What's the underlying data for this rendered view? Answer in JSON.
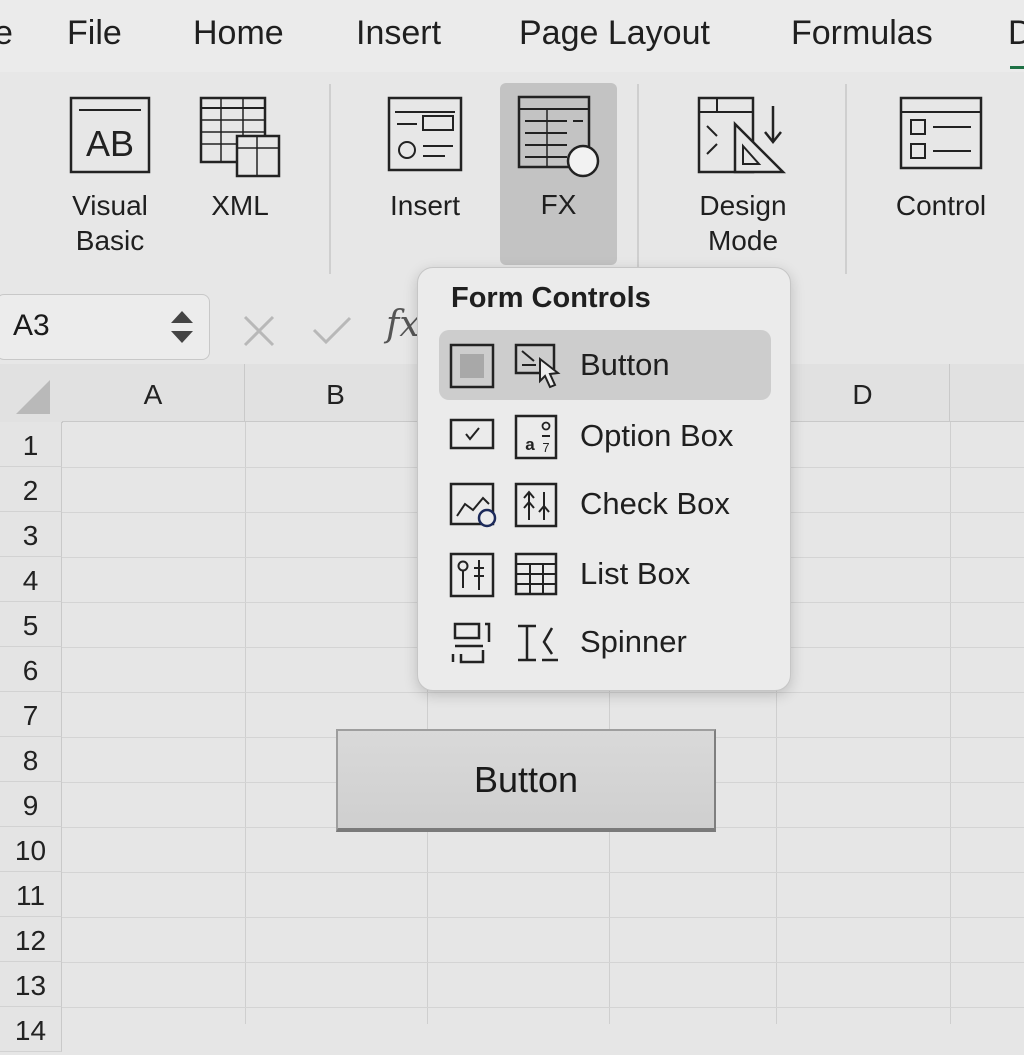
{
  "menubar": {
    "tabs": [
      {
        "label": "e"
      },
      {
        "label": "File"
      },
      {
        "label": "Home"
      },
      {
        "label": "Insert"
      },
      {
        "label": "Page Layout"
      },
      {
        "label": "Formulas"
      },
      {
        "label": "D"
      }
    ]
  },
  "ribbon": {
    "visual_basic": {
      "label": "Visual\nBasic",
      "icon": "visual-basic-icon"
    },
    "xml": {
      "label": "XML",
      "icon": "xml-icon"
    },
    "insert": {
      "label": "Insert",
      "icon": "insert-controls-icon"
    },
    "fx": {
      "label": "FX",
      "icon": "fx-icon"
    },
    "design_mode": {
      "label": "Design\nMode",
      "icon": "design-mode-icon"
    },
    "control": {
      "label": "Control",
      "icon": "control-icon"
    }
  },
  "formula_bar": {
    "name_box": "A3",
    "fx": "fx"
  },
  "grid": {
    "columns": [
      "A",
      "B",
      "",
      "",
      "D"
    ],
    "rows": [
      "1",
      "2",
      "3",
      "4",
      "5",
      "6",
      "7",
      "8",
      "9",
      "10",
      "11",
      "12",
      "13",
      "14"
    ],
    "sheet_button_label": "Button"
  },
  "dropdown": {
    "title": "Form Controls",
    "items": [
      {
        "label": "Button",
        "icons": [
          "square-stop-icon",
          "cursor-select-icon"
        ],
        "selected": true
      },
      {
        "label": "Option Box",
        "icons": [
          "checkbox-check-icon",
          "option-figure-icon"
        ],
        "selected": false
      },
      {
        "label": "Check Box",
        "icons": [
          "chart-circle-icon",
          "arrows-up-icon"
        ],
        "selected": false
      },
      {
        "label": "List Box",
        "icons": [
          "slider-pins-icon",
          "table-grid-icon"
        ],
        "selected": false
      },
      {
        "label": "Spinner",
        "icons": [
          "frame-brackets-icon",
          "text-bracket-icon"
        ],
        "selected": false
      }
    ]
  },
  "colors": {
    "accent": "#1e7145",
    "selected_bg": "#cdcdcd",
    "ribbon_active_bg": "#c3c3c3"
  }
}
